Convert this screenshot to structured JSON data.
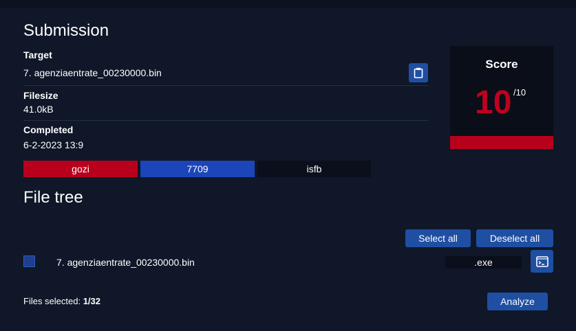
{
  "submission": {
    "title": "Submission",
    "target_label": "Target",
    "target_value": "7. agenziaentrate_00230000.bin",
    "filesize_label": "Filesize",
    "filesize_value": "41.0kB",
    "completed_label": "Completed",
    "completed_value": "6-2-2023 13:9",
    "tags": [
      {
        "label": "gozi",
        "color": "#b8001d"
      },
      {
        "label": "7709",
        "color": "#1b45b9"
      },
      {
        "label": "isfb",
        "color": "#0a0f1b"
      }
    ]
  },
  "score": {
    "title": "Score",
    "value": "10",
    "max": "/10",
    "fraction": 1.0,
    "accent": "#c0001f"
  },
  "file_tree": {
    "title": "File tree",
    "select_all_label": "Select all",
    "deselect_all_label": "Deselect all",
    "files": [
      {
        "name": "7. agenziaentrate_00230000.bin",
        "ext": ".exe",
        "checked": true
      }
    ],
    "files_selected_label": "Files selected:",
    "files_selected_value": "1/32",
    "analyze_label": "Analyze"
  },
  "icons": {
    "copy": "clipboard-icon",
    "terminal": "terminal-icon"
  }
}
